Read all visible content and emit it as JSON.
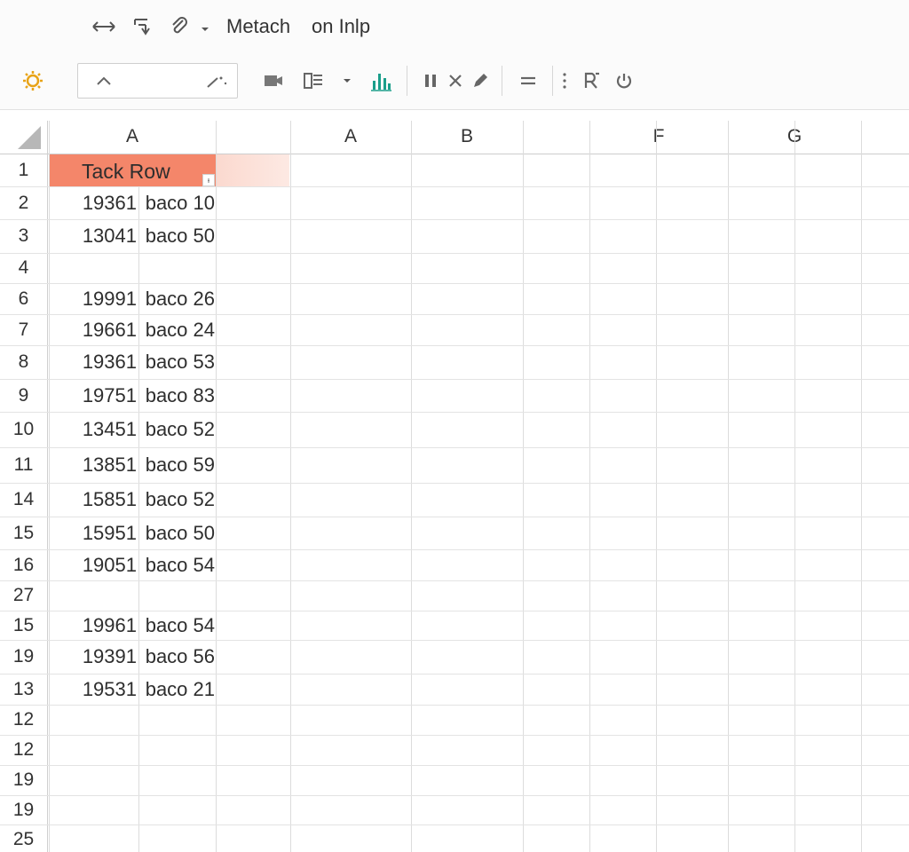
{
  "titlebar": {
    "icons": [
      "resize-arrows-icon",
      "document-edit-icon",
      "paperclip-icon",
      "chevron-down-icon"
    ],
    "menu_items": [
      "Metach",
      "on Inlp"
    ]
  },
  "toolbar": {
    "icons": [
      "sun-icon",
      "formula-icon",
      "comment-icon",
      "list-icon",
      "chevron-down-icon",
      "chart-icon",
      "pause-icon",
      "x-icon",
      "pen-icon",
      "equals-icon",
      "more-icon",
      "r-icon",
      "power-icon"
    ],
    "accent": "#e8a317",
    "chart_color": "#1a9e8a"
  },
  "grid": {
    "column_headers": [
      "A",
      "A",
      "B",
      "F",
      "G"
    ],
    "header_row": {
      "row_label": "1",
      "text": "Tack Row",
      "fill": "#f4866a",
      "filter_glyph": "ᵻ"
    },
    "rows": [
      {
        "row": "2",
        "a": "19361",
        "b": "baco 10"
      },
      {
        "row": "3",
        "a": "13041",
        "b": "baco 50"
      },
      {
        "row": "4",
        "a": "",
        "b": ""
      },
      {
        "row": "6",
        "a": "19991",
        "b": "baco 26"
      },
      {
        "row": "7",
        "a": "19661",
        "b": "baco 24"
      },
      {
        "row": "8",
        "a": "19361",
        "b": "baco 53"
      },
      {
        "row": "9",
        "a": "19751",
        "b": "baco 83"
      },
      {
        "row": "10",
        "a": "13451",
        "b": "baco 52"
      },
      {
        "row": "11",
        "a": "13851",
        "b": "baco 59"
      },
      {
        "row": "14",
        "a": "15851",
        "b": "baco 52"
      },
      {
        "row": "15",
        "a": "15951",
        "b": "baco 50"
      },
      {
        "row": "16",
        "a": "19051",
        "b": "baco 54"
      },
      {
        "row": "27",
        "a": "",
        "b": ""
      },
      {
        "row": "15",
        "a": "19961",
        "b": "baco 54"
      },
      {
        "row": "19",
        "a": "19391",
        "b": "baco 56"
      },
      {
        "row": "13",
        "a": "19531",
        "b": "baco 21"
      },
      {
        "row": "12",
        "a": "",
        "b": ""
      },
      {
        "row": "12",
        "a": "",
        "b": ""
      },
      {
        "row": "19",
        "a": "",
        "b": ""
      },
      {
        "row": "19",
        "a": "",
        "b": ""
      },
      {
        "row": "25",
        "a": "",
        "b": ""
      }
    ]
  }
}
